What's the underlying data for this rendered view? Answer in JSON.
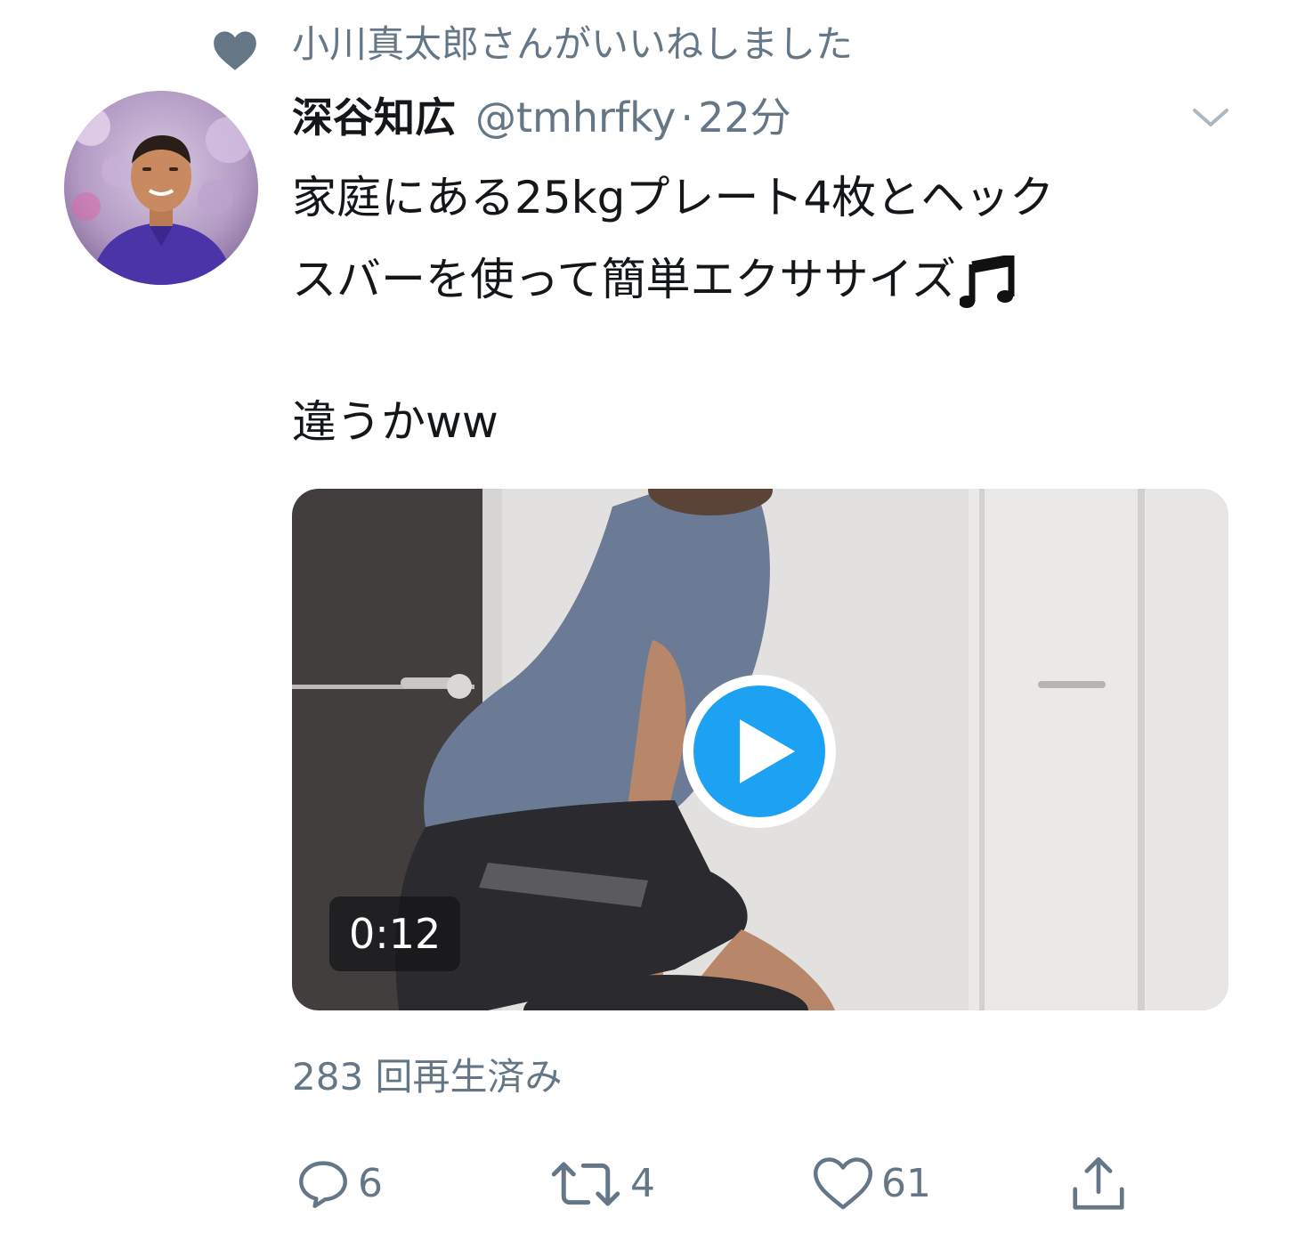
{
  "context": {
    "icon": "heart-icon",
    "text": "小川真太郎さんがいいねしました"
  },
  "author": {
    "display_name": "深谷知広",
    "handle": "@tmhrfky",
    "separator": "·",
    "time": "22分"
  },
  "tweet": {
    "lines": [
      "家庭にある25kgプレート4枚とヘック",
      "スバーを使って簡単エクササイズ"
    ],
    "emoji": "music-notes-icon",
    "last_line": "違うかww"
  },
  "video": {
    "duration": "0:12",
    "views": "283 回再生済み"
  },
  "actions": {
    "reply_count": "6",
    "retweet_count": "4",
    "like_count": "61"
  },
  "colors": {
    "secondary_text": "#657786",
    "primary_text": "#14171a",
    "accent": "#1da1f2"
  }
}
